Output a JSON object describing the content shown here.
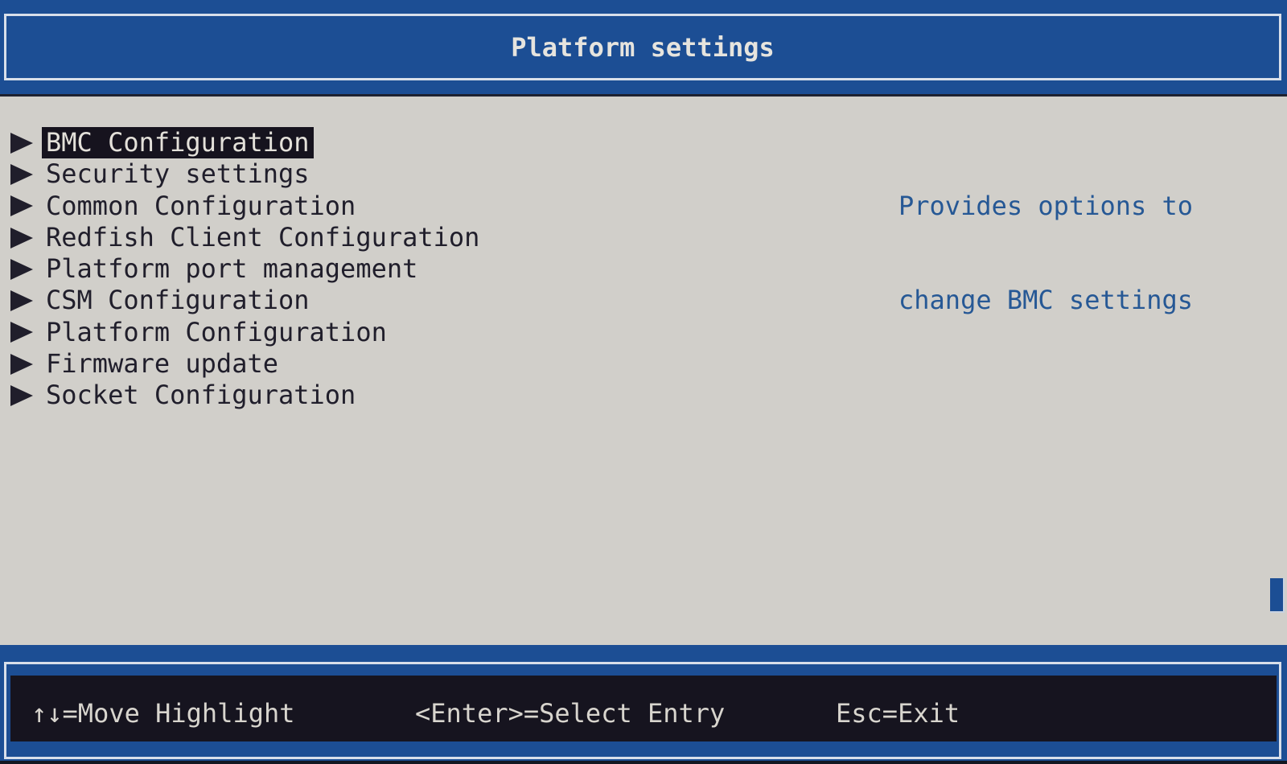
{
  "title_bar": {
    "title": "Platform settings"
  },
  "menu": {
    "arrow_icon": "right-pointer",
    "items": [
      {
        "label": "BMC Configuration",
        "selected": true
      },
      {
        "label": "Security settings",
        "selected": false
      },
      {
        "label": "Common Configuration",
        "selected": false
      },
      {
        "label": "Redfish Client Configuration",
        "selected": false
      },
      {
        "label": "Platform port management",
        "selected": false
      },
      {
        "label": "CSM Configuration",
        "selected": false
      },
      {
        "label": "Platform Configuration",
        "selected": false
      },
      {
        "label": "Firmware update",
        "selected": false
      },
      {
        "label": "Socket Configuration",
        "selected": false
      }
    ]
  },
  "help_panel": {
    "line1": "Provides options to",
    "line2": "change BMC settings"
  },
  "footer": {
    "hotkeys": [
      {
        "label": "↑↓=Move Highlight"
      },
      {
        "label": "<Enter>=Select Entry"
      },
      {
        "label": "Esc=Exit"
      }
    ]
  },
  "colors": {
    "accent_blue": "#1c4e94",
    "background_gray": "#d1cfca",
    "highlight_dark": "#16131e",
    "help_text_blue": "#265895",
    "frame_light": "#d8dfea"
  }
}
